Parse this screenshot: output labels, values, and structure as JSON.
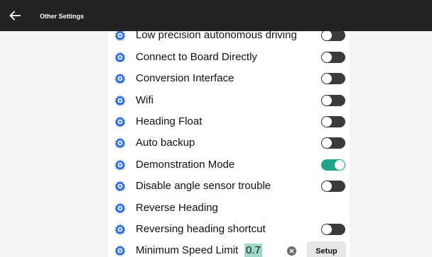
{
  "header": {
    "title": "Other Settings",
    "back_icon": "arrow-left-icon",
    "background": "#222222"
  },
  "settings": {
    "icon": "gear-icon",
    "accent_color": "#1fa589",
    "items": [
      {
        "label": "Low precision autonomous driving",
        "enabled": false
      },
      {
        "label": "Connect to Board Directly",
        "enabled": false
      },
      {
        "label": "Conversion Interface",
        "enabled": false
      },
      {
        "label": "Wifi",
        "enabled": false
      },
      {
        "label": "Heading Float",
        "enabled": false
      },
      {
        "label": "Auto backup",
        "enabled": false
      },
      {
        "label": "Demonstration Mode",
        "enabled": true
      },
      {
        "label": "Disable angle sensor trouble",
        "enabled": false
      },
      {
        "label": "Reverse Heading"
      },
      {
        "label": "Reversing heading shortcut",
        "enabled": false
      }
    ],
    "min_speed": {
      "label": "Minimum Speed Limit",
      "value": "0.7",
      "clear_icon": "clear-icon",
      "setup_label": "Setup"
    }
  }
}
